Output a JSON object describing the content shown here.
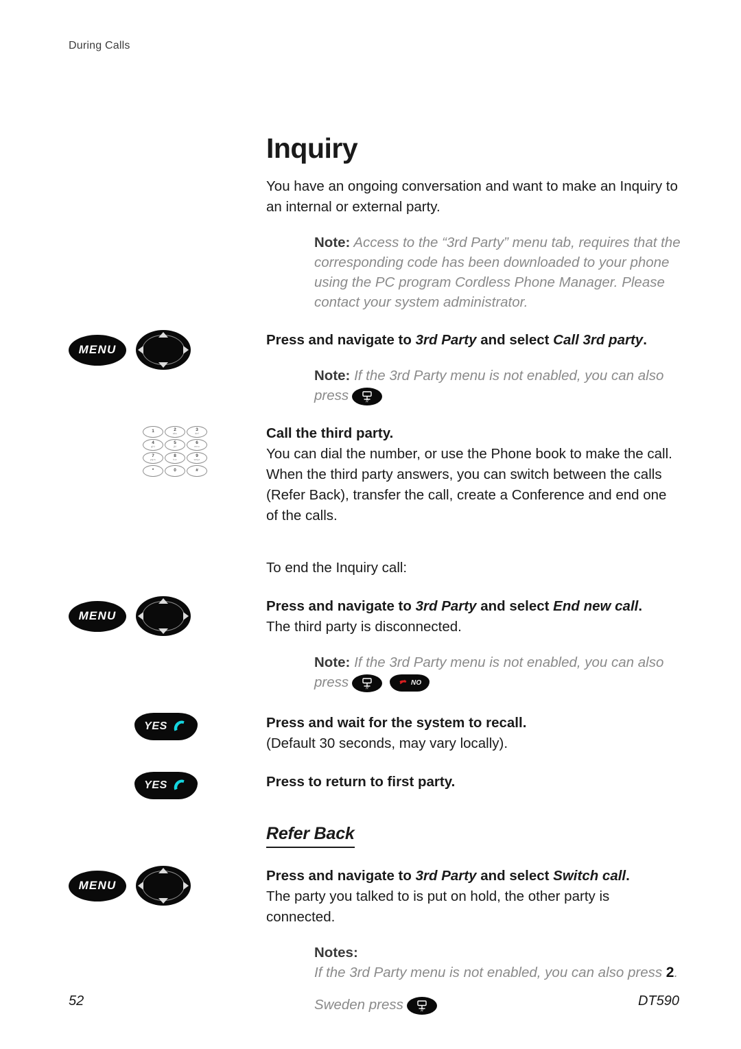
{
  "document": {
    "running_header": "During Calls",
    "page_number": "52",
    "model": "DT590"
  },
  "section": {
    "title": "Inquiry",
    "intro": "You have an ongoing conversation and want to make an Inquiry to an internal or external party.",
    "note1_label": "Note:",
    "note1_text": "Access to the “3rd Party” menu tab, requires that the corresponding code has been downloaded to your phone using the PC program Cordless Phone Manager. Please contact your system administrator.",
    "step1": {
      "lead": "Press and navigate to ",
      "menu_name": "3rd Party",
      "mid": " and select ",
      "selection": "Call 3rd party",
      "end": "."
    },
    "note2_label": "Note:",
    "note2_text": "If the 3rd Party menu is not enabled, you can also press",
    "call_third_party_heading": "Call the third party.",
    "call_third_party_body": "You can dial the number, or use the Phone book to make the call. When the third party answers, you can switch between the calls (Refer Back), transfer the call, create a Conference and end one of the calls.",
    "end_inquiry_intro": "To end the Inquiry call:",
    "step2": {
      "lead": "Press and navigate to ",
      "menu_name": "3rd Party",
      "mid": " and select ",
      "selection": "End new call",
      "end": "."
    },
    "step2_result": "The third party is disconnected.",
    "note3_label": "Note:",
    "note3_text": "If the 3rd Party menu is not enabled, you can also press",
    "step3_heading": "Press and wait for the system to recall.",
    "step3_body": "(Default 30 seconds, may vary locally).",
    "step4_heading": "Press to return to first party."
  },
  "refer_back": {
    "heading": "Refer Back",
    "step": {
      "lead": "Press and navigate to ",
      "menu_name": "3rd Party",
      "mid": " and select ",
      "selection": "Switch call",
      "end": "."
    },
    "step_result": "The party you talked to is put on hold, the other party is connected.",
    "notes_label": "Notes:",
    "note_a_prefix": "If the 3rd Party menu is not enabled, you can also press ",
    "note_a_key": "2",
    "note_a_suffix": ".",
    "note_b": "Sweden press"
  },
  "keys": {
    "menu_label": "MENU",
    "yes_label": "YES",
    "no_label": "NO",
    "recall_label": "R",
    "nav_icon": "four-way-navigation-key",
    "keypad_icon": "numeric-keypad"
  },
  "keypad": [
    {
      "num": "1",
      "ltr": ""
    },
    {
      "num": "2",
      "ltr": "abc"
    },
    {
      "num": "3",
      "ltr": "def"
    },
    {
      "num": "4",
      "ltr": "ghi"
    },
    {
      "num": "5",
      "ltr": "jkl"
    },
    {
      "num": "6",
      "ltr": "mno"
    },
    {
      "num": "7",
      "ltr": "pqrs"
    },
    {
      "num": "8",
      "ltr": "tuv"
    },
    {
      "num": "9",
      "ltr": "wxyz"
    },
    {
      "num": "*",
      "ltr": ""
    },
    {
      "num": "0",
      "ltr": ""
    },
    {
      "num": "#",
      "ltr": ""
    }
  ],
  "colors": {
    "key_black": "#0a0a0a",
    "yes_handset": "#15d6e0",
    "no_handset": "#d81f20",
    "note_gray": "#8a8a8a"
  }
}
